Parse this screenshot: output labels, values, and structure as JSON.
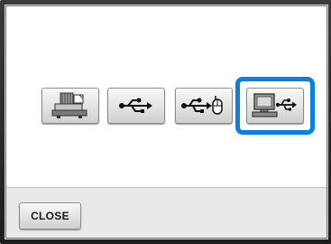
{
  "dialog": {
    "options": [
      {
        "icon": "embroidery-machine-memory-icon",
        "selected": false
      },
      {
        "icon": "usb-icon",
        "selected": false
      },
      {
        "icon": "usb-mouse-port-icon",
        "selected": false
      },
      {
        "icon": "computer-usb-icon",
        "selected": true
      }
    ],
    "selection_color": "#0a7fe6"
  },
  "footer": {
    "close_label": "CLOSE"
  }
}
